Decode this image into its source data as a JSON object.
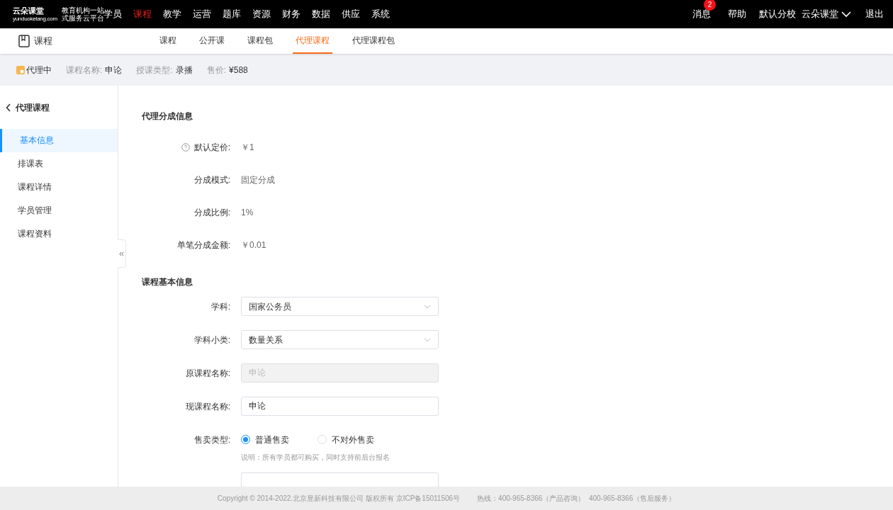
{
  "top_nav": {
    "logo": {
      "name": "云朵课堂",
      "tagline": [
        "教育机构一站",
        "式服务云平台"
      ],
      "url": "yunduoketang.com"
    },
    "menu": [
      {
        "label": "学员",
        "selected": false
      },
      {
        "label": "课程",
        "selected": true
      },
      {
        "label": "教学",
        "selected": false
      },
      {
        "label": "运营",
        "selected": false
      },
      {
        "label": "题库",
        "selected": false
      },
      {
        "label": "资源",
        "selected": false
      },
      {
        "label": "财务",
        "selected": false
      },
      {
        "label": "数据",
        "selected": false
      },
      {
        "label": "供应",
        "selected": false
      },
      {
        "label": "系统",
        "selected": false
      }
    ],
    "messages": {
      "label": "消息",
      "badge": "2"
    },
    "help": "帮助",
    "school": "默认分校",
    "user": "云朵课堂",
    "logout": "退出"
  },
  "sub_nav": {
    "title": "课程",
    "tabs": [
      {
        "label": "课程",
        "selected": false
      },
      {
        "label": "公开课",
        "selected": false
      },
      {
        "label": "课程包",
        "selected": false
      },
      {
        "label": "代理课程",
        "selected": true
      },
      {
        "label": "代理课程包",
        "selected": false
      }
    ]
  },
  "info_bar": {
    "status": "代理中",
    "fields": [
      {
        "label": "课程名称:",
        "value": "申论"
      },
      {
        "label": "授课类型:",
        "value": "录播"
      },
      {
        "label": "售价:",
        "value": "¥588"
      }
    ]
  },
  "sidebar": {
    "back": "代理课程",
    "items": [
      {
        "label": "基本信息",
        "selected": true
      },
      {
        "label": "排课表",
        "selected": false
      },
      {
        "label": "课程详情",
        "selected": false
      },
      {
        "label": "学员管理",
        "selected": false
      },
      {
        "label": "课程资料",
        "selected": false
      }
    ]
  },
  "sections": [
    {
      "title": "代理分成信息",
      "rows": [
        {
          "kind": "text",
          "label": "默认定价:",
          "value": "￥1",
          "help": true
        },
        {
          "kind": "text",
          "label": "分成模式:",
          "value": "固定分成",
          "help": false
        },
        {
          "kind": "text",
          "label": "分成比例:",
          "value": "1%",
          "help": false
        },
        {
          "kind": "text",
          "label": "单笔分成金额:",
          "value": "￥0.01",
          "help": false
        }
      ]
    },
    {
      "title": "课程基本信息",
      "rows": [
        {
          "kind": "select",
          "label": "学科:",
          "value": "国家公务员"
        },
        {
          "kind": "select",
          "label": "学科小类:",
          "value": "数量关系"
        },
        {
          "kind": "input",
          "label": "原课程名称:",
          "value": "申论",
          "disabled": true
        },
        {
          "kind": "input",
          "label": "现课程名称:",
          "value": "申论",
          "disabled": false
        },
        {
          "kind": "radio",
          "label": "售卖类型:",
          "options": [
            {
              "label": "普通售卖",
              "selected": true
            },
            {
              "label": "不对外售卖",
              "selected": false
            }
          ],
          "note": "说明：所有学员都可购买，同时支持前后台报名"
        },
        {
          "kind": "blank"
        }
      ]
    }
  ],
  "footer": {
    "copyright": "Copyright © 2014-2022.北京昱新科技有限公司 版权所有 京ICP备15011506号",
    "hotline": "热线：400-965-8366（产品咨询）  400-965-8366（售后服务）"
  }
}
